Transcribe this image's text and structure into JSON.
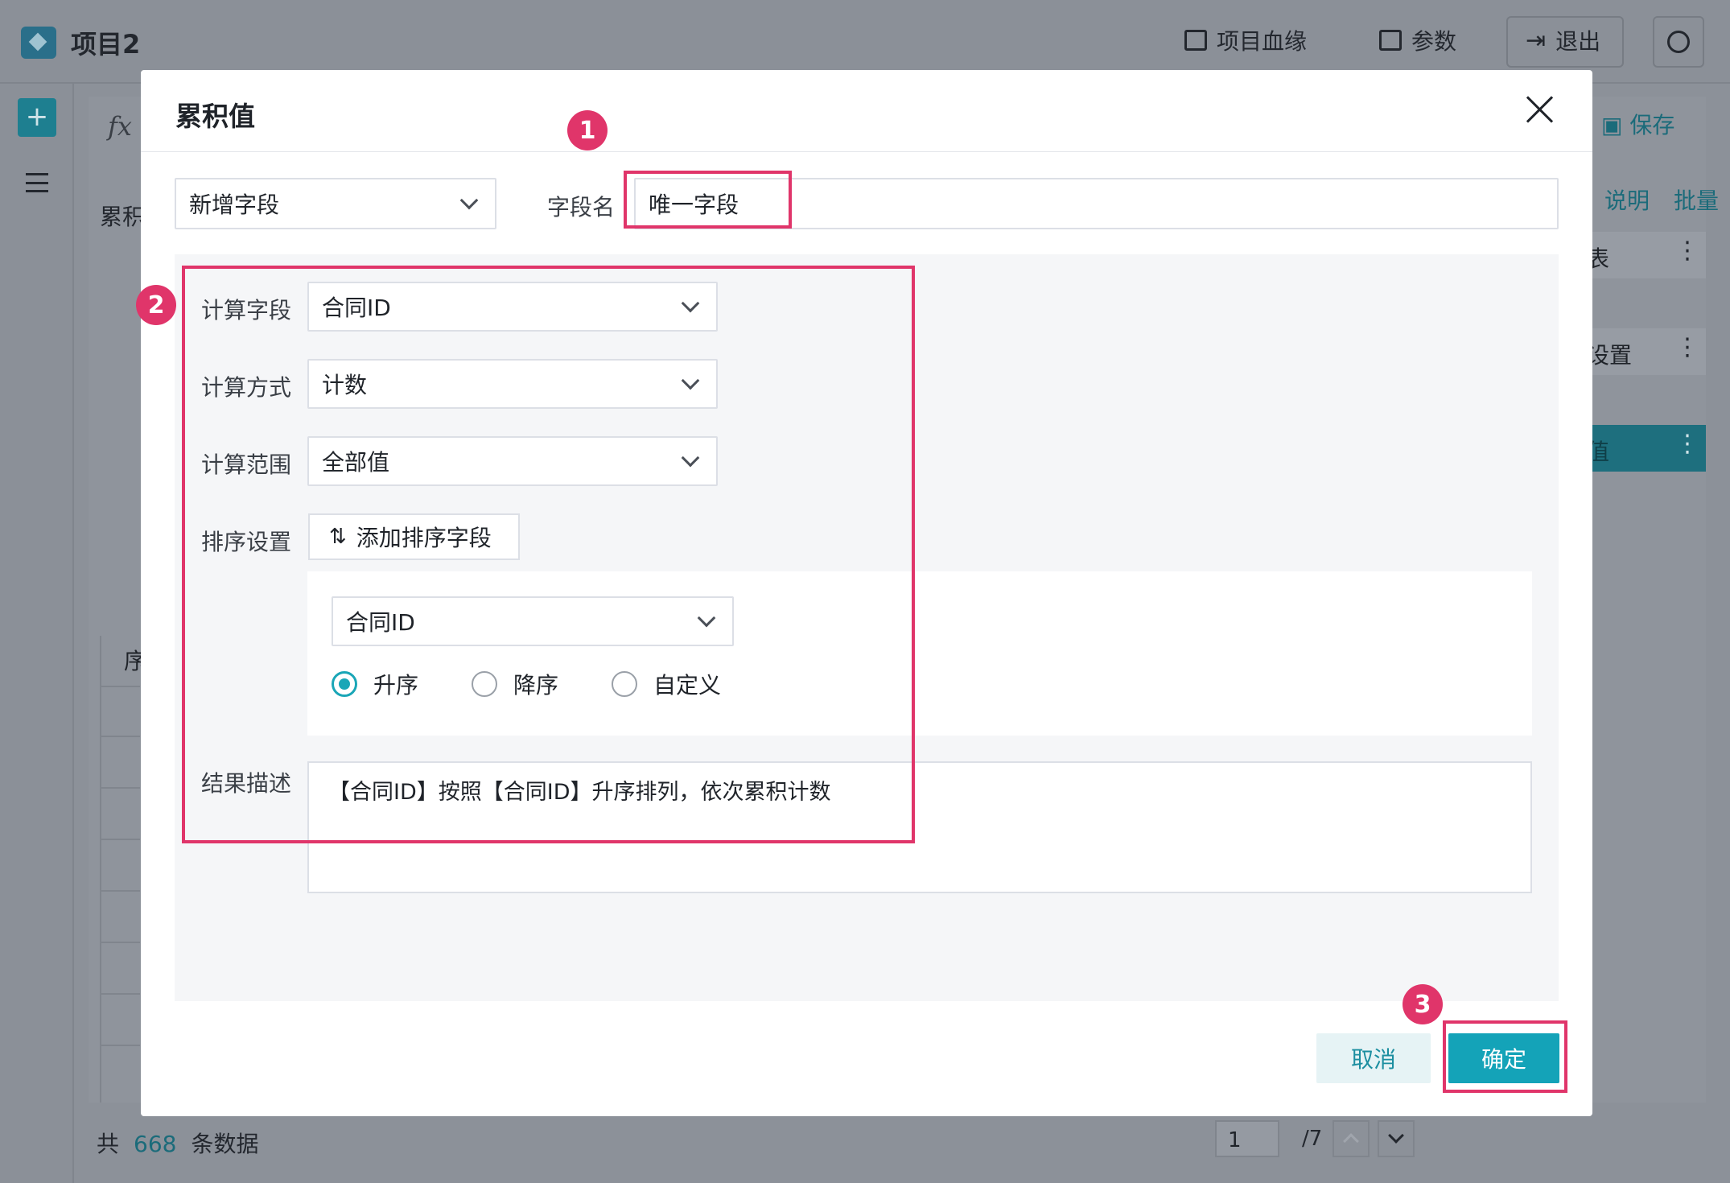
{
  "app": {
    "project_title": "项目2",
    "header": {
      "lineage": "项目血缘",
      "params": "参数",
      "exit": "退出"
    },
    "toolbar": {
      "save": "保存"
    },
    "side_links": {
      "help": "说明",
      "batch": "批量"
    },
    "panel_label_partial": "累积",
    "table_header_partial": "序",
    "side_rows": {
      "row1_partial": "表",
      "row2_partial": "设置",
      "row3_partial": "值"
    },
    "footer": {
      "prefix": "共",
      "count": "668",
      "suffix": "条数据",
      "page": "1",
      "total_pages": "/7"
    }
  },
  "modal": {
    "title": "累积值",
    "field_type": "新增字段",
    "field_name_label": "字段名",
    "field_name_value": "唯一字段",
    "calc_field_label": "计算字段",
    "calc_field_value": "合同ID",
    "calc_method_label": "计算方式",
    "calc_method_value": "计数",
    "calc_range_label": "计算范围",
    "calc_range_value": "全部值",
    "sort_label": "排序设置",
    "add_sort_button": "添加排序字段",
    "sort_field_value": "合同ID",
    "sort_options": [
      "升序",
      "降序",
      "自定义"
    ],
    "sort_selected": "升序",
    "result_desc_label": "结果描述",
    "result_desc_value": "【合同ID】按照【合同ID】升序排列，依次累积计数",
    "cancel_button": "取消",
    "confirm_button": "确定"
  },
  "annotations": {
    "badge1": "1",
    "badge2": "2",
    "badge3": "3",
    "color": "#e0356a"
  },
  "colors": {
    "accent": "#14a3b8",
    "overlay": "#8e939b"
  }
}
